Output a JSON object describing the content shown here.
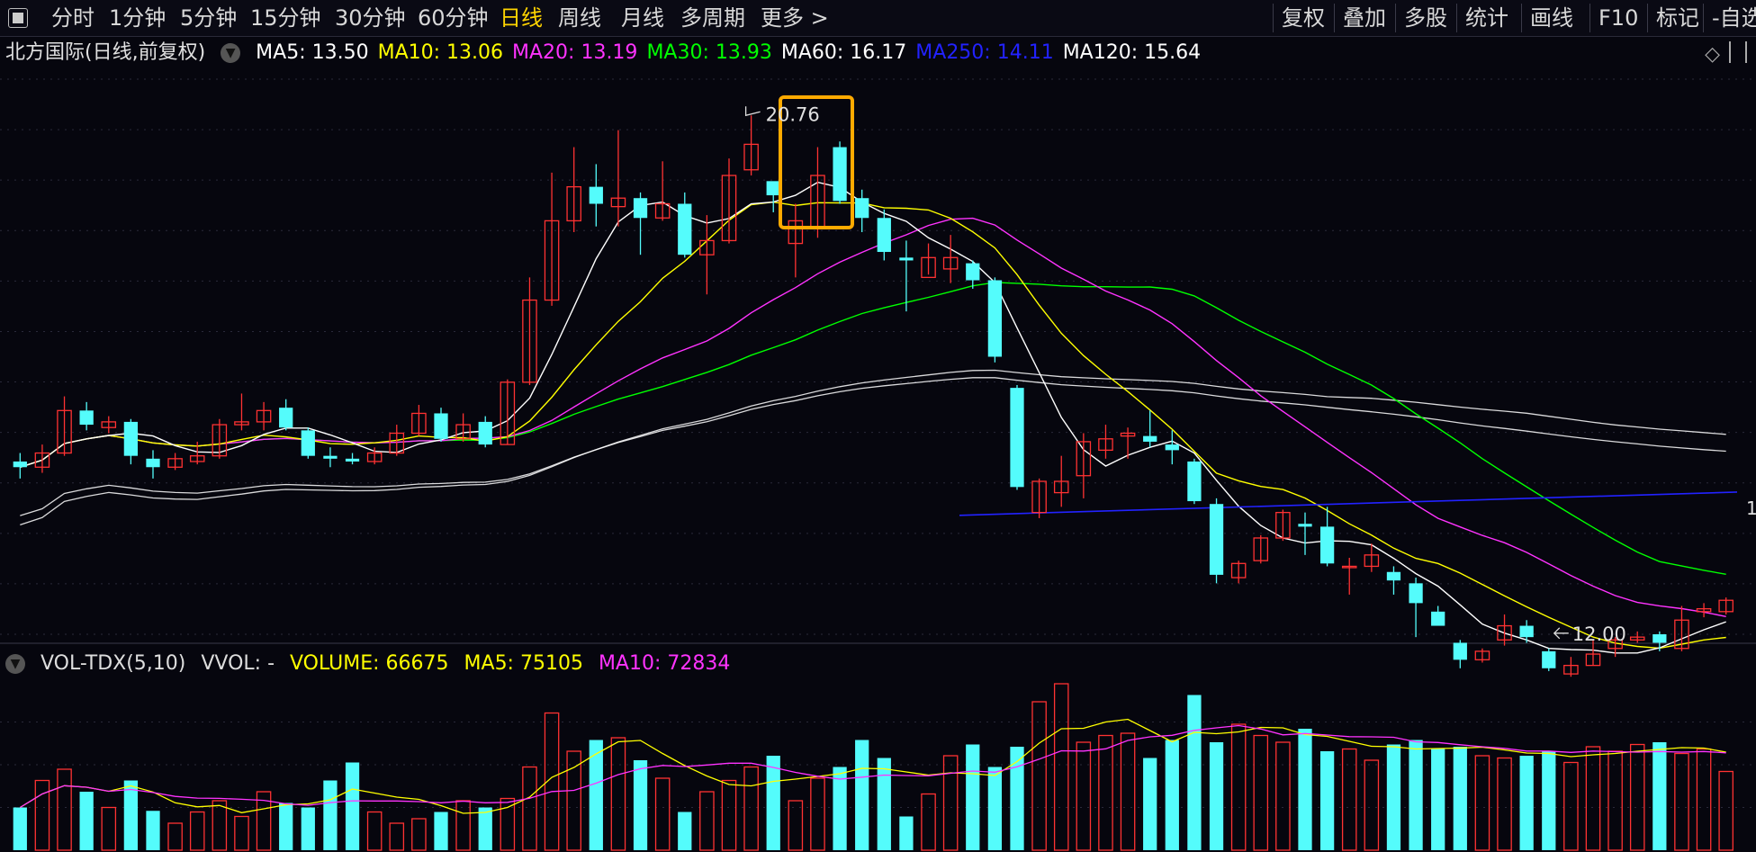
{
  "toolbar": {
    "periods": [
      "分时",
      "1分钟",
      "5分钟",
      "15分钟",
      "30分钟",
      "60分钟",
      "日线",
      "周线",
      "月线",
      "多周期",
      "更多 >"
    ],
    "active_period": "日线",
    "tools": [
      "复权",
      "叠加",
      "多股",
      "统计",
      "画线",
      "F10",
      "标记",
      "-自选"
    ]
  },
  "main_legend": {
    "title": "北方国际(日线,前复权)",
    "ma": [
      {
        "label": "MA5: 13.50",
        "color": "#ffffff"
      },
      {
        "label": "MA10: 13.06",
        "color": "#ffff00"
      },
      {
        "label": "MA20: 13.19",
        "color": "#ff33ff"
      },
      {
        "label": "MA30: 13.93",
        "color": "#00ff00"
      },
      {
        "label": "MA60: 16.17",
        "color": "#ffffff"
      },
      {
        "label": "MA250: 14.11",
        "color": "#2222ff"
      },
      {
        "label": "MA120: 15.64",
        "color": "#ffffff"
      }
    ]
  },
  "vol_legend": {
    "title": "VOL-TDX(5,10)",
    "vvol": "VVOL: -",
    "volume": "VOLUME: 66675",
    "ma5": "MA5: 75105",
    "ma10": "MA10: 72834"
  },
  "annotations": {
    "high_label": "20.76",
    "low_label": "12.00",
    "right_edge": "1"
  },
  "colors": {
    "up": "#ff3232",
    "down": "#54fcfc",
    "ma5": "#ffffff",
    "ma10": "#ffff00",
    "ma20": "#ff33ff",
    "ma30": "#00ff00",
    "ma60": "#ffffff",
    "ma120": "#ffffff",
    "ma250": "#2222ff",
    "highlight": "#ffaa00",
    "grid": "#2a2a3a"
  },
  "chart_data": [
    {
      "type": "candlestick",
      "price_range": [
        11.6,
        21.4
      ],
      "candles": [
        [
          14.65,
          14.55,
          14.8,
          14.35
        ],
        [
          14.55,
          14.8,
          14.95,
          14.45
        ],
        [
          14.8,
          15.55,
          15.8,
          14.75
        ],
        [
          15.55,
          15.3,
          15.7,
          15.2
        ],
        [
          15.25,
          15.35,
          15.45,
          15.15
        ],
        [
          15.35,
          14.75,
          15.4,
          14.6
        ],
        [
          14.7,
          14.55,
          14.85,
          14.35
        ],
        [
          14.55,
          14.7,
          14.8,
          14.5
        ],
        [
          14.65,
          14.75,
          15.0,
          14.6
        ],
        [
          14.75,
          15.3,
          15.4,
          14.7
        ],
        [
          15.3,
          15.35,
          15.85,
          15.2
        ],
        [
          15.35,
          15.55,
          15.7,
          15.2
        ],
        [
          15.6,
          15.25,
          15.75,
          15.2
        ],
        [
          15.2,
          14.75,
          15.25,
          14.7
        ],
        [
          14.75,
          14.7,
          14.9,
          14.55
        ],
        [
          14.7,
          14.65,
          14.8,
          14.6
        ],
        [
          14.65,
          14.8,
          14.9,
          14.6
        ],
        [
          14.8,
          15.15,
          15.3,
          14.75
        ],
        [
          15.15,
          15.5,
          15.65,
          15.1
        ],
        [
          15.5,
          15.05,
          15.6,
          15.0
        ],
        [
          15.05,
          15.3,
          15.5,
          15.0
        ],
        [
          15.35,
          14.95,
          15.45,
          14.9
        ],
        [
          14.95,
          16.05,
          16.1,
          14.95
        ],
        [
          16.05,
          17.5,
          17.9,
          16.0
        ],
        [
          17.5,
          18.9,
          19.75,
          17.4
        ],
        [
          18.9,
          19.5,
          20.2,
          18.7
        ],
        [
          19.5,
          19.2,
          19.9,
          18.8
        ],
        [
          19.15,
          19.3,
          20.5,
          18.8
        ],
        [
          19.3,
          18.95,
          19.4,
          18.3
        ],
        [
          18.95,
          19.2,
          19.95,
          18.9
        ],
        [
          19.2,
          18.3,
          19.4,
          18.25
        ],
        [
          18.3,
          18.55,
          19.0,
          17.6
        ],
        [
          18.55,
          19.7,
          20.0,
          18.5
        ],
        [
          19.8,
          20.25,
          20.76,
          19.7
        ],
        [
          19.6,
          19.35,
          19.5,
          19.05
        ],
        [
          18.5,
          18.9,
          19.2,
          17.9
        ],
        [
          18.8,
          19.7,
          20.2,
          18.6
        ],
        [
          20.2,
          19.25,
          20.3,
          19.2
        ],
        [
          19.3,
          18.95,
          19.45,
          18.7
        ],
        [
          18.95,
          18.35,
          19.1,
          18.2
        ],
        [
          18.25,
          18.2,
          18.55,
          17.3
        ],
        [
          17.9,
          18.25,
          18.5,
          17.95
        ],
        [
          18.05,
          18.25,
          18.65,
          17.8
        ],
        [
          18.15,
          17.85,
          18.2,
          17.7
        ],
        [
          17.85,
          16.5,
          17.9,
          16.4
        ],
        [
          15.95,
          14.2,
          16.0,
          14.15
        ],
        [
          13.75,
          14.3,
          14.35,
          13.65
        ],
        [
          14.1,
          14.3,
          14.75,
          13.85
        ],
        [
          14.4,
          15.0,
          15.15,
          14.0
        ],
        [
          14.85,
          15.05,
          15.3,
          14.7
        ],
        [
          15.1,
          15.15,
          15.25,
          14.7
        ],
        [
          15.1,
          15.0,
          15.55,
          14.9
        ],
        [
          14.95,
          14.85,
          15.2,
          14.6
        ],
        [
          14.65,
          13.95,
          14.7,
          13.9
        ],
        [
          13.9,
          12.65,
          14.0,
          12.5
        ],
        [
          12.6,
          12.85,
          12.9,
          12.5
        ],
        [
          12.9,
          13.3,
          13.35,
          12.85
        ],
        [
          13.3,
          13.75,
          13.8,
          13.25
        ],
        [
          13.55,
          13.5,
          13.75,
          13.0
        ],
        [
          13.5,
          12.85,
          13.85,
          12.8
        ],
        [
          12.8,
          12.8,
          12.95,
          12.3
        ],
        [
          12.8,
          13.0,
          13.2,
          12.7
        ],
        [
          12.7,
          12.55,
          12.8,
          12.3
        ],
        [
          12.5,
          12.15,
          12.6,
          11.55
        ],
        [
          12.0,
          11.75,
          12.1,
          11.9
        ],
        [
          11.45,
          11.15,
          11.5,
          11.0
        ],
        [
          11.15,
          11.3,
          11.35,
          11.1
        ],
        [
          11.5,
          11.75,
          11.95,
          11.4
        ],
        [
          11.75,
          11.55,
          11.85,
          11.45
        ],
        [
          11.3,
          11.0,
          11.35,
          10.95
        ],
        [
          10.9,
          11.05,
          11.2,
          10.85
        ],
        [
          11.05,
          11.25,
          11.5,
          11.05
        ],
        [
          11.35,
          11.5,
          11.55,
          11.2
        ],
        [
          11.5,
          11.55,
          11.65,
          11.45
        ],
        [
          11.6,
          11.45,
          11.65,
          11.3
        ],
        [
          11.35,
          11.85,
          12.1,
          11.3
        ],
        [
          12.0,
          12.05,
          12.15,
          11.9
        ],
        [
          12.0,
          12.2,
          12.25,
          11.95
        ]
      ],
      "low_mark": 12.0,
      "high_mark": 20.76
    },
    {
      "type": "bar",
      "name": "VOLUME",
      "volume_range": [
        0,
        152000
      ],
      "volumes": [
        38,
        62,
        72,
        52,
        38,
        62,
        35,
        24,
        34,
        44,
        30,
        52,
        42,
        38,
        62,
        78,
        34,
        24,
        28,
        34,
        44,
        38,
        46,
        74,
        122,
        88,
        98,
        100,
        80,
        64,
        34,
        52,
        62,
        74,
        84,
        44,
        64,
        74,
        98,
        82,
        30,
        50,
        84,
        94,
        74,
        92,
        132,
        148,
        96,
        102,
        104,
        82,
        98,
        138,
        96,
        112,
        102,
        96,
        108,
        88,
        90,
        80,
        94,
        98,
        90,
        92,
        84,
        82,
        84,
        88,
        78,
        92,
        88,
        94,
        96,
        86,
        90,
        70
      ],
      "volumes_unit": "k"
    }
  ]
}
